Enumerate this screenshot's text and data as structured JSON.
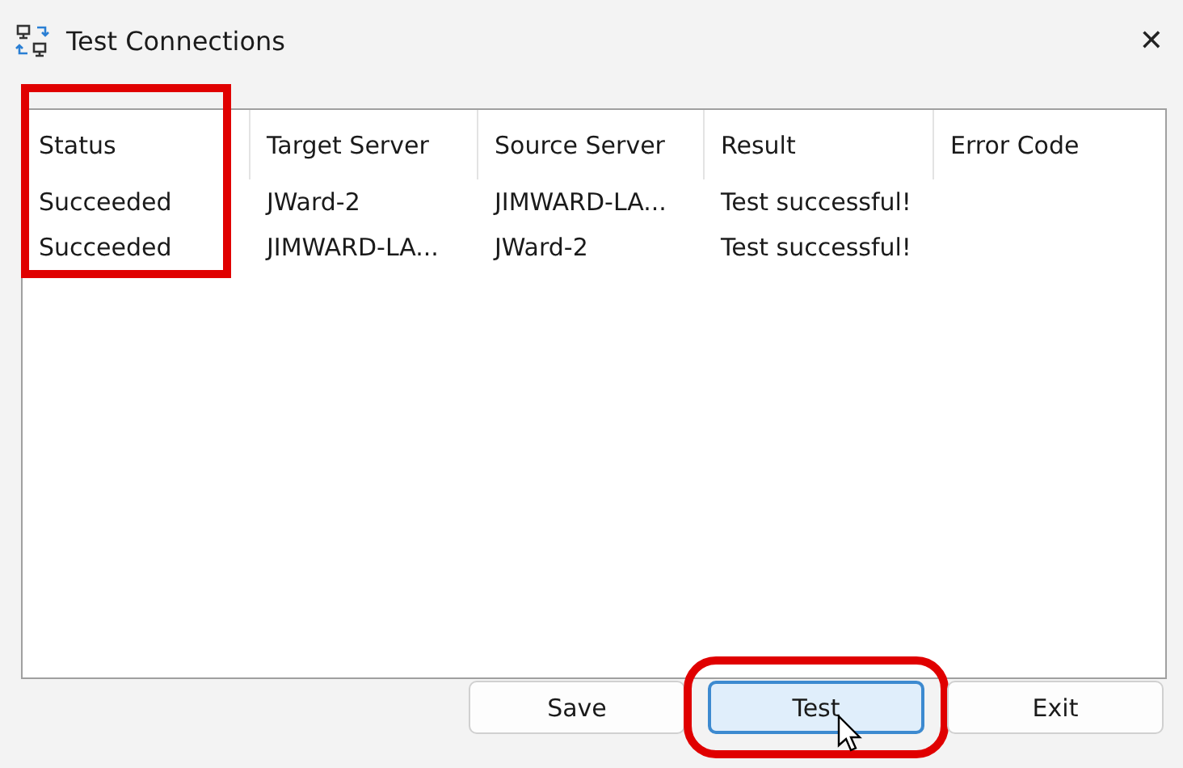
{
  "window": {
    "title": "Test Connections",
    "close_glyph": "✕"
  },
  "table": {
    "columns": [
      {
        "label": "Status",
        "highlighted": true
      },
      {
        "label": "Target Server",
        "highlighted": false
      },
      {
        "label": "Source Server",
        "highlighted": false
      },
      {
        "label": "Result",
        "highlighted": false
      },
      {
        "label": "Error Code",
        "highlighted": false
      }
    ],
    "rows": [
      [
        "Succeeded",
        "JWard-2",
        "JIMWARD-LA...",
        "Test successful!",
        ""
      ],
      [
        "Succeeded",
        "JIMWARD-LA...",
        "JWard-2",
        "Test successful!",
        ""
      ]
    ]
  },
  "buttons": [
    {
      "label": "Save",
      "focused": false,
      "highlighted": false,
      "hovered": false
    },
    {
      "label": "Test",
      "focused": true,
      "highlighted": true,
      "hovered": true
    },
    {
      "label": "Exit",
      "focused": false,
      "highlighted": false,
      "hovered": false
    }
  ]
}
